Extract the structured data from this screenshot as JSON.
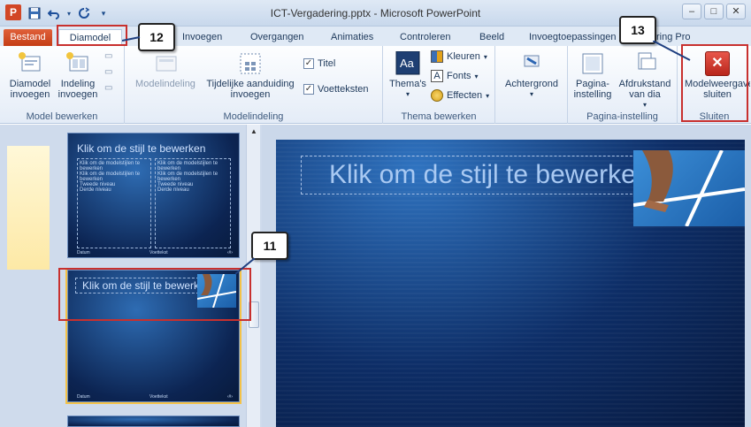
{
  "window": {
    "title": "ICT-Vergadering.pptx - Microsoft PowerPoint",
    "app_icon_letter": "P",
    "controls": [
      "–",
      "□",
      "✕"
    ]
  },
  "tabs": [
    {
      "label": "Bestand"
    },
    {
      "label": "Diamodel"
    },
    {
      "label": "Invoegen"
    },
    {
      "label": "Overgangen"
    },
    {
      "label": "Animaties"
    },
    {
      "label": "Controleren"
    },
    {
      "label": "Beeld"
    },
    {
      "label": "Invoegtoepassingen"
    },
    {
      "label": "ring Pro"
    }
  ],
  "ribbon": {
    "model_bewerken": {
      "label": "Model bewerken",
      "diamodel_invoegen": "Diamodel invoegen",
      "indeling_invoegen": "Indeling invoegen"
    },
    "modelindeling": {
      "label": "Modelindeling",
      "modelindeling_btn": "Modelindeling",
      "tijdelijke_aanduiding": "Tijdelijke aanduiding invoegen",
      "titel": "Titel",
      "voetteksten": "Voetteksten"
    },
    "thema_bewerken": {
      "label": "Thema bewerken",
      "themas": "Thema's",
      "kleuren": "Kleuren",
      "fonts": "Fonts",
      "effecten": "Effecten"
    },
    "achtergrond": {
      "label": "Achtergrond"
    },
    "pagina_instelling": {
      "label": "Pagina-instelling",
      "pagina_instelling_btn": "Pagina-instelling",
      "afdrukstand": "Afdrukstand van dia"
    },
    "sluiten": {
      "label": "Sluiten",
      "modelweergave_sluiten": "Modelweergave sluiten"
    }
  },
  "thumbnails": [
    {
      "title": "Klik om de stijl te bewerken",
      "left_col": [
        "Klik om de modelstijlen te",
        "bewerken",
        "Klik om de modelstijlen te",
        "bewerken",
        "Tweede niveau",
        "Derde niveau"
      ],
      "right_col": [
        "Klik om de modelstijlen te",
        "bewerken",
        "Klik om de modelstijlen te",
        "bewerken",
        "Tweede niveau",
        "Derde niveau"
      ],
      "footer": [
        "Datum",
        "Voettekst",
        "‹#›"
      ]
    },
    {
      "title": "Klik om de stijl te bewerken",
      "footer": [
        "Datum",
        "Voettekst",
        "‹#›"
      ]
    }
  ],
  "slide": {
    "title": "Klik om de stijl te bewerken"
  },
  "callouts": [
    "12",
    "13",
    "11"
  ],
  "colors": {
    "file_tab": "#c53d16",
    "highlight_red": "#c8302e",
    "slide_blue": "#0d2d66",
    "close_btn_red": "#d9352a"
  }
}
